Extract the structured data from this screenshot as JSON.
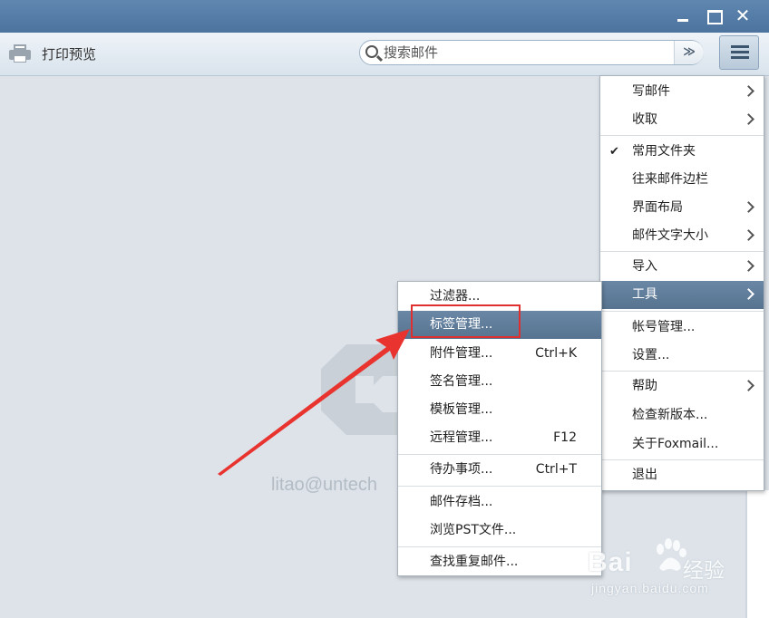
{
  "toolbar": {
    "print_label": "打印预览",
    "search_placeholder": "搜索邮件",
    "search_dropdown_glyph": "≫"
  },
  "window_controls": {
    "close_glyph": "✕"
  },
  "content": {
    "account": "litao@untech"
  },
  "main_menu": {
    "items": [
      {
        "label": "写邮件",
        "submenu": true
      },
      {
        "label": "收取",
        "submenu": true
      },
      {
        "label": "常用文件夹",
        "checked": true
      },
      {
        "label": "往来邮件边栏"
      },
      {
        "label": "界面布局",
        "submenu": true
      },
      {
        "label": "邮件文字大小",
        "submenu": true
      },
      {
        "label": "导入",
        "submenu": true
      },
      {
        "label": "工具",
        "submenu": true,
        "active": true
      },
      {
        "label": "帐号管理..."
      },
      {
        "label": "设置..."
      },
      {
        "label": "帮助",
        "submenu": true
      },
      {
        "label": "检查新版本..."
      },
      {
        "label": "关于Foxmail..."
      },
      {
        "label": "退出"
      }
    ],
    "check_glyph": "✔"
  },
  "tools_submenu": {
    "items": [
      {
        "label": "过滤器..."
      },
      {
        "label": "标签管理...",
        "active": true
      },
      {
        "label": "附件管理...",
        "shortcut": "Ctrl+K"
      },
      {
        "label": "签名管理..."
      },
      {
        "label": "模板管理..."
      },
      {
        "label": "远程管理...",
        "shortcut": "F12"
      },
      {
        "label": "待办事项...",
        "shortcut": "Ctrl+T"
      },
      {
        "label": "邮件存档..."
      },
      {
        "label": "浏览PST文件..."
      },
      {
        "label": "查找重复邮件..."
      }
    ]
  },
  "annotation": {
    "highlight_color": "#e02f2f"
  },
  "watermark": {
    "brand": "Bai",
    "brand_suffix": "经验",
    "url": "jingyan.baidu.com"
  },
  "colors": {
    "titlebar": "#4b739e",
    "menu_active": "#5d7a98",
    "background": "#dde3e9"
  }
}
